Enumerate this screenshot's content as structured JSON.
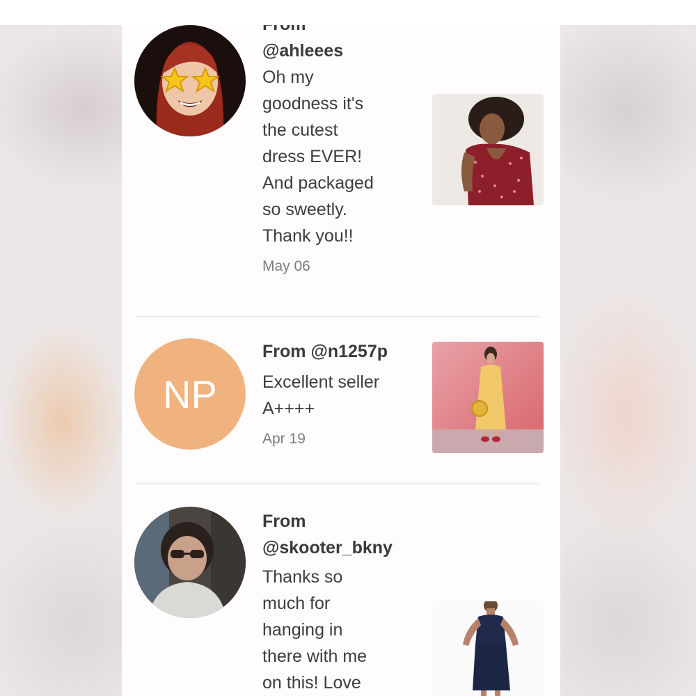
{
  "reviews": [
    {
      "from_label": "From",
      "handle": "@ahleees",
      "message_lines": [
        "Oh my",
        "goodness it's",
        "the cutest",
        "dress EVER!",
        "And packaged",
        "so sweetly.",
        "Thank you!!"
      ],
      "date": "May 06",
      "avatar_icon": "bitmoji-avatar-with-star-sunglasses",
      "thumbnail_icon": "red-floral-dress-photo"
    },
    {
      "from_label": "From",
      "handle": "@n1257p",
      "initials": "NP",
      "avatar_color": "#f0b27f",
      "message_lines": [
        "Excellent seller",
        "A++++"
      ],
      "date": "Apr 19",
      "thumbnail_icon": "yellow-dress-photo"
    },
    {
      "from_label": "From",
      "handle": "@skooter_bkny",
      "message_lines": [
        "Thanks so",
        "much for",
        "hanging in",
        "there with me",
        "on this! Love"
      ],
      "avatar_icon": "profile-photo-avatar",
      "thumbnail_icon": "navy-dress-photo"
    }
  ]
}
